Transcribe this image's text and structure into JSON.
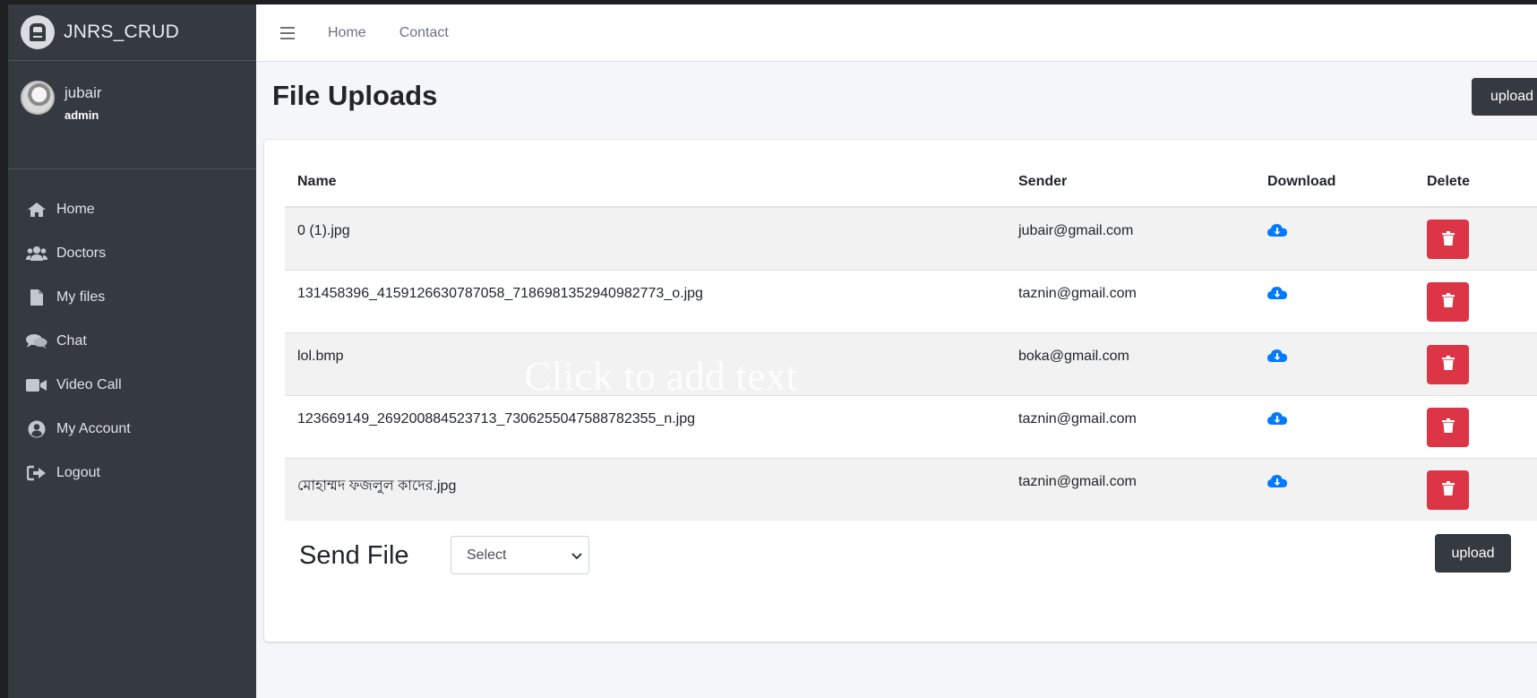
{
  "brand": {
    "title": "JNRS_CRUD"
  },
  "user": {
    "name": "jubair",
    "role": "admin"
  },
  "sidebar": {
    "items": [
      {
        "label": "Home",
        "icon": "home-icon"
      },
      {
        "label": "Doctors",
        "icon": "users-icon"
      },
      {
        "label": "My files",
        "icon": "file-icon"
      },
      {
        "label": "Chat",
        "icon": "chat-icon"
      },
      {
        "label": "Video Call",
        "icon": "video-icon"
      },
      {
        "label": "My Account",
        "icon": "user-circle-icon"
      },
      {
        "label": "Logout",
        "icon": "logout-icon"
      }
    ]
  },
  "topbar": {
    "links": [
      "Home",
      "Contact"
    ]
  },
  "page": {
    "title": "File Uploads",
    "upload_label": "upload"
  },
  "table": {
    "headers": {
      "name": "Name",
      "sender": "Sender",
      "download": "Download",
      "delete": "Delete"
    },
    "rows": [
      {
        "name": "0 (1).jpg",
        "sender": "jubair@gmail.com"
      },
      {
        "name": "131458396_4159126630787058_7186981352940982773_o.jpg",
        "sender": "taznin@gmail.com"
      },
      {
        "name": "lol.bmp",
        "sender": "boka@gmail.com"
      },
      {
        "name": "123669149_269200884523713_7306255047588782355_n.jpg",
        "sender": "taznin@gmail.com"
      },
      {
        "name": "মোহাম্মদ ফজলুল কাদের.jpg",
        "sender": "taznin@gmail.com"
      }
    ]
  },
  "overlay": {
    "text": "Click to add text"
  },
  "send": {
    "label": "Send File",
    "select_value": "Select",
    "upload_label": "upload"
  },
  "colors": {
    "sidebar": "#343a40",
    "accent_blue": "#007bff",
    "danger": "#dc3545",
    "dark_button": "#343a40"
  }
}
